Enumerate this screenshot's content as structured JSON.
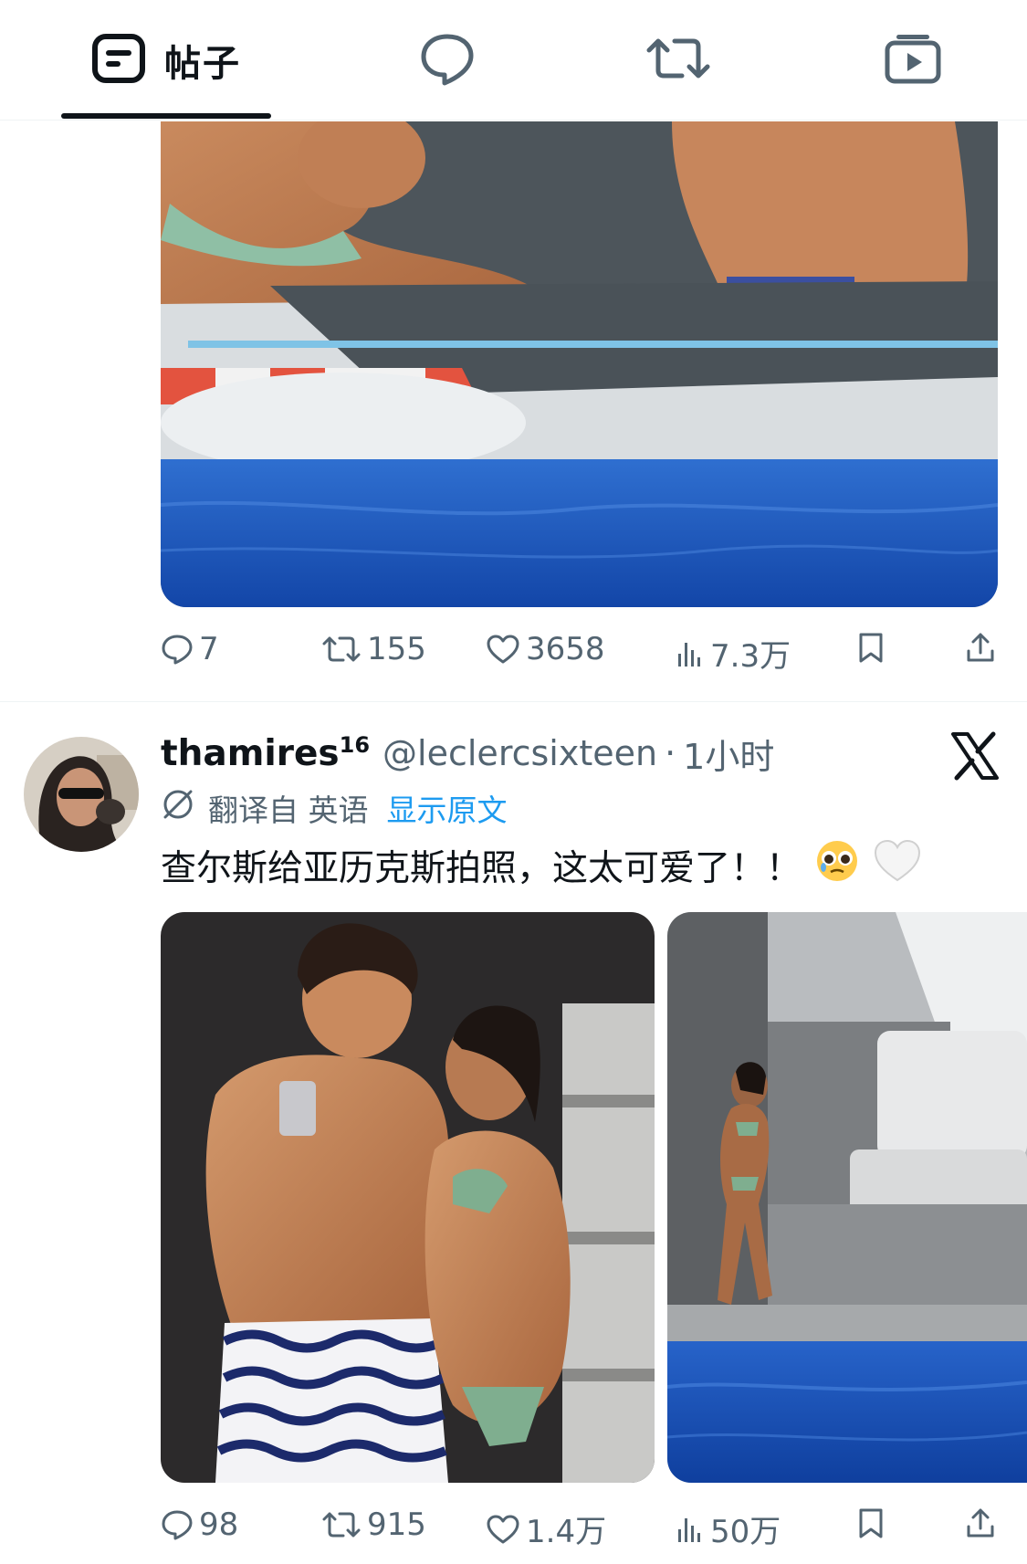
{
  "tabs": {
    "posts_label": "帖子",
    "items": [
      {
        "name": "posts",
        "icon": "posts-icon",
        "label": "帖子",
        "selected": true
      },
      {
        "name": "replies",
        "icon": "speech-bubble-icon"
      },
      {
        "name": "reposts",
        "icon": "repost-icon"
      },
      {
        "name": "media",
        "icon": "media-play-icon"
      }
    ]
  },
  "tweet1": {
    "photo": "boat-deck-photo",
    "stats": {
      "replies": "7",
      "reposts": "155",
      "likes": "3658",
      "views": "7.3万"
    }
  },
  "tweet2": {
    "display_name": "thamires",
    "name_sup": "16",
    "handle": "@leclercsixteen",
    "dot": "·",
    "time": "1小时",
    "translate": {
      "from": "翻译自 英语",
      "show": "显示原文"
    },
    "text": "查尔斯给亚历克斯拍照，这太可爱了！！",
    "emojis": [
      "🥹",
      "🤍"
    ],
    "photos": [
      "couple-phone-photo",
      "woman-on-yacht-photo"
    ],
    "stats": {
      "replies": "98",
      "reposts": "915",
      "likes": "1.4万",
      "views": "50万"
    }
  },
  "colors": {
    "text": "#0f1419",
    "secondary": "#536471",
    "accent": "#1d9bf0",
    "divider": "#eff3f4"
  }
}
